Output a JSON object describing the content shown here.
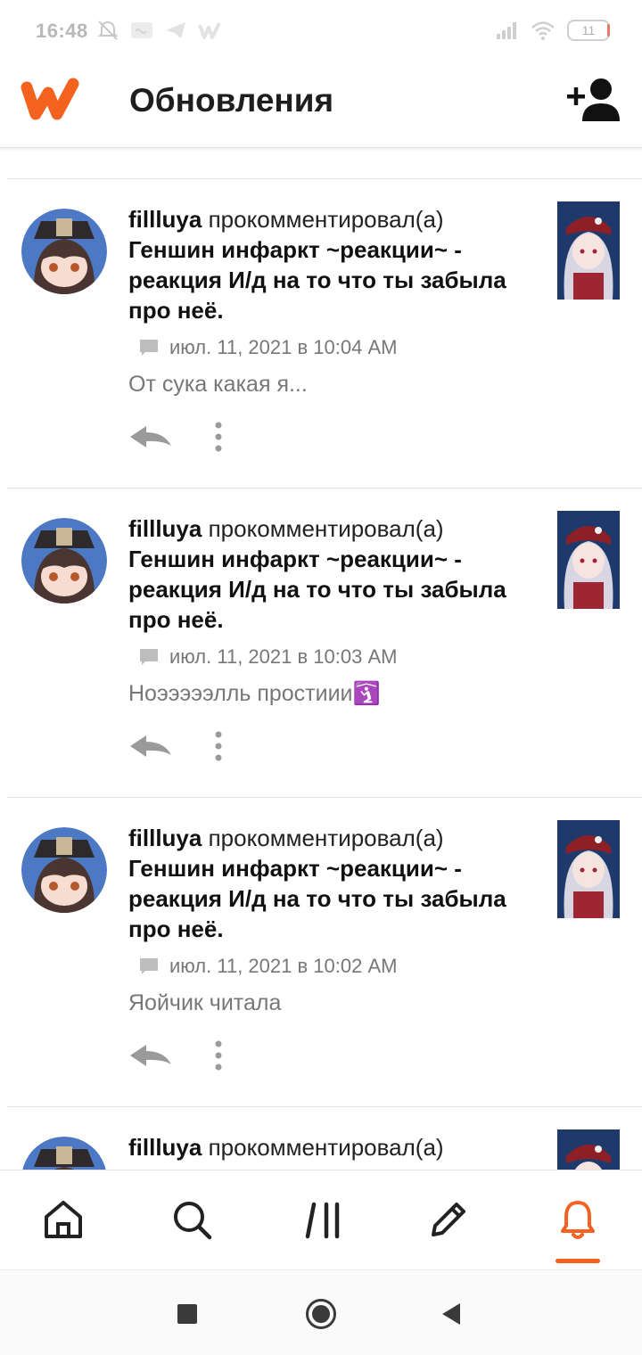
{
  "status_bar": {
    "time": "16:48",
    "battery": "11"
  },
  "app_bar": {
    "title": "Обновления"
  },
  "colors": {
    "accent": "#f4621f",
    "meta_text": "#777777"
  },
  "feed": [
    {
      "user": "fillluya",
      "action": "прокомментировал(а)",
      "story": "Геншин инфаркт ~реакции~ - реакция И/д на то что ты забыла про неё.",
      "timestamp": "июл. 11, 2021 в 10:04 AM",
      "comment": "От сука какая я..."
    },
    {
      "user": "fillluya",
      "action": "прокомментировал(а)",
      "story": "Геншин инфаркт ~реакции~ - реакция И/д на то что ты забыла про неё.",
      "timestamp": "июл. 11, 2021 в 10:03 AM",
      "comment": "Ноэээээлль простиии🛐"
    },
    {
      "user": "fillluya",
      "action": "прокомментировал(а)",
      "story": "Геншин инфаркт ~реакции~ - реакция И/д на то что ты забыла про неё.",
      "timestamp": "июл. 11, 2021 в 10:02 AM",
      "comment": "Яойчик читала"
    },
    {
      "user": "fillluya",
      "action": "прокомментировал(а)",
      "story": "",
      "timestamp": "",
      "comment": ""
    }
  ],
  "bottom_nav": [
    {
      "icon": "home-icon",
      "active": false
    },
    {
      "icon": "search-icon",
      "active": false
    },
    {
      "icon": "library-icon",
      "active": false
    },
    {
      "icon": "pencil-icon",
      "active": false
    },
    {
      "icon": "bell-icon",
      "active": true
    }
  ]
}
